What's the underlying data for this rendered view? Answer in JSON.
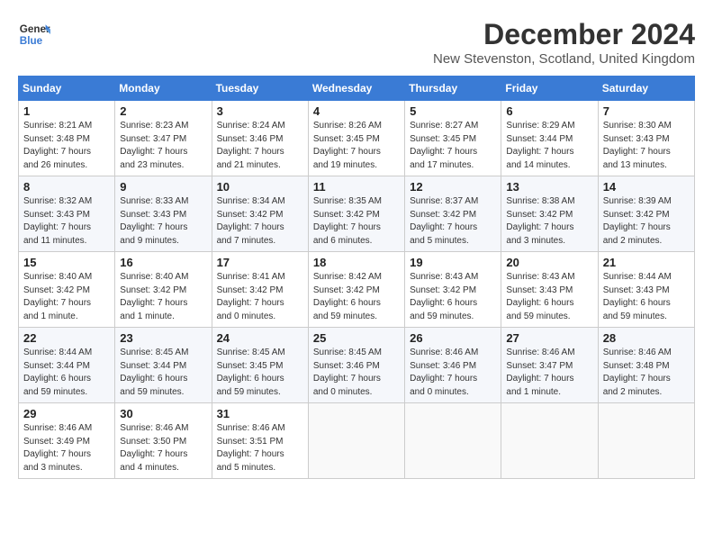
{
  "logo": {
    "line1": "General",
    "line2": "Blue"
  },
  "title": "December 2024",
  "location": "New Stevenston, Scotland, United Kingdom",
  "weekdays": [
    "Sunday",
    "Monday",
    "Tuesday",
    "Wednesday",
    "Thursday",
    "Friday",
    "Saturday"
  ],
  "weeks": [
    [
      {
        "day": "1",
        "detail": "Sunrise: 8:21 AM\nSunset: 3:48 PM\nDaylight: 7 hours\nand 26 minutes."
      },
      {
        "day": "2",
        "detail": "Sunrise: 8:23 AM\nSunset: 3:47 PM\nDaylight: 7 hours\nand 23 minutes."
      },
      {
        "day": "3",
        "detail": "Sunrise: 8:24 AM\nSunset: 3:46 PM\nDaylight: 7 hours\nand 21 minutes."
      },
      {
        "day": "4",
        "detail": "Sunrise: 8:26 AM\nSunset: 3:45 PM\nDaylight: 7 hours\nand 19 minutes."
      },
      {
        "day": "5",
        "detail": "Sunrise: 8:27 AM\nSunset: 3:45 PM\nDaylight: 7 hours\nand 17 minutes."
      },
      {
        "day": "6",
        "detail": "Sunrise: 8:29 AM\nSunset: 3:44 PM\nDaylight: 7 hours\nand 14 minutes."
      },
      {
        "day": "7",
        "detail": "Sunrise: 8:30 AM\nSunset: 3:43 PM\nDaylight: 7 hours\nand 13 minutes."
      }
    ],
    [
      {
        "day": "8",
        "detail": "Sunrise: 8:32 AM\nSunset: 3:43 PM\nDaylight: 7 hours\nand 11 minutes."
      },
      {
        "day": "9",
        "detail": "Sunrise: 8:33 AM\nSunset: 3:43 PM\nDaylight: 7 hours\nand 9 minutes."
      },
      {
        "day": "10",
        "detail": "Sunrise: 8:34 AM\nSunset: 3:42 PM\nDaylight: 7 hours\nand 7 minutes."
      },
      {
        "day": "11",
        "detail": "Sunrise: 8:35 AM\nSunset: 3:42 PM\nDaylight: 7 hours\nand 6 minutes."
      },
      {
        "day": "12",
        "detail": "Sunrise: 8:37 AM\nSunset: 3:42 PM\nDaylight: 7 hours\nand 5 minutes."
      },
      {
        "day": "13",
        "detail": "Sunrise: 8:38 AM\nSunset: 3:42 PM\nDaylight: 7 hours\nand 3 minutes."
      },
      {
        "day": "14",
        "detail": "Sunrise: 8:39 AM\nSunset: 3:42 PM\nDaylight: 7 hours\nand 2 minutes."
      }
    ],
    [
      {
        "day": "15",
        "detail": "Sunrise: 8:40 AM\nSunset: 3:42 PM\nDaylight: 7 hours\nand 1 minute."
      },
      {
        "day": "16",
        "detail": "Sunrise: 8:40 AM\nSunset: 3:42 PM\nDaylight: 7 hours\nand 1 minute."
      },
      {
        "day": "17",
        "detail": "Sunrise: 8:41 AM\nSunset: 3:42 PM\nDaylight: 7 hours\nand 0 minutes."
      },
      {
        "day": "18",
        "detail": "Sunrise: 8:42 AM\nSunset: 3:42 PM\nDaylight: 6 hours\nand 59 minutes."
      },
      {
        "day": "19",
        "detail": "Sunrise: 8:43 AM\nSunset: 3:42 PM\nDaylight: 6 hours\nand 59 minutes."
      },
      {
        "day": "20",
        "detail": "Sunrise: 8:43 AM\nSunset: 3:43 PM\nDaylight: 6 hours\nand 59 minutes."
      },
      {
        "day": "21",
        "detail": "Sunrise: 8:44 AM\nSunset: 3:43 PM\nDaylight: 6 hours\nand 59 minutes."
      }
    ],
    [
      {
        "day": "22",
        "detail": "Sunrise: 8:44 AM\nSunset: 3:44 PM\nDaylight: 6 hours\nand 59 minutes."
      },
      {
        "day": "23",
        "detail": "Sunrise: 8:45 AM\nSunset: 3:44 PM\nDaylight: 6 hours\nand 59 minutes."
      },
      {
        "day": "24",
        "detail": "Sunrise: 8:45 AM\nSunset: 3:45 PM\nDaylight: 6 hours\nand 59 minutes."
      },
      {
        "day": "25",
        "detail": "Sunrise: 8:45 AM\nSunset: 3:46 PM\nDaylight: 7 hours\nand 0 minutes."
      },
      {
        "day": "26",
        "detail": "Sunrise: 8:46 AM\nSunset: 3:46 PM\nDaylight: 7 hours\nand 0 minutes."
      },
      {
        "day": "27",
        "detail": "Sunrise: 8:46 AM\nSunset: 3:47 PM\nDaylight: 7 hours\nand 1 minute."
      },
      {
        "day": "28",
        "detail": "Sunrise: 8:46 AM\nSunset: 3:48 PM\nDaylight: 7 hours\nand 2 minutes."
      }
    ],
    [
      {
        "day": "29",
        "detail": "Sunrise: 8:46 AM\nSunset: 3:49 PM\nDaylight: 7 hours\nand 3 minutes."
      },
      {
        "day": "30",
        "detail": "Sunrise: 8:46 AM\nSunset: 3:50 PM\nDaylight: 7 hours\nand 4 minutes."
      },
      {
        "day": "31",
        "detail": "Sunrise: 8:46 AM\nSunset: 3:51 PM\nDaylight: 7 hours\nand 5 minutes."
      },
      null,
      null,
      null,
      null
    ]
  ]
}
